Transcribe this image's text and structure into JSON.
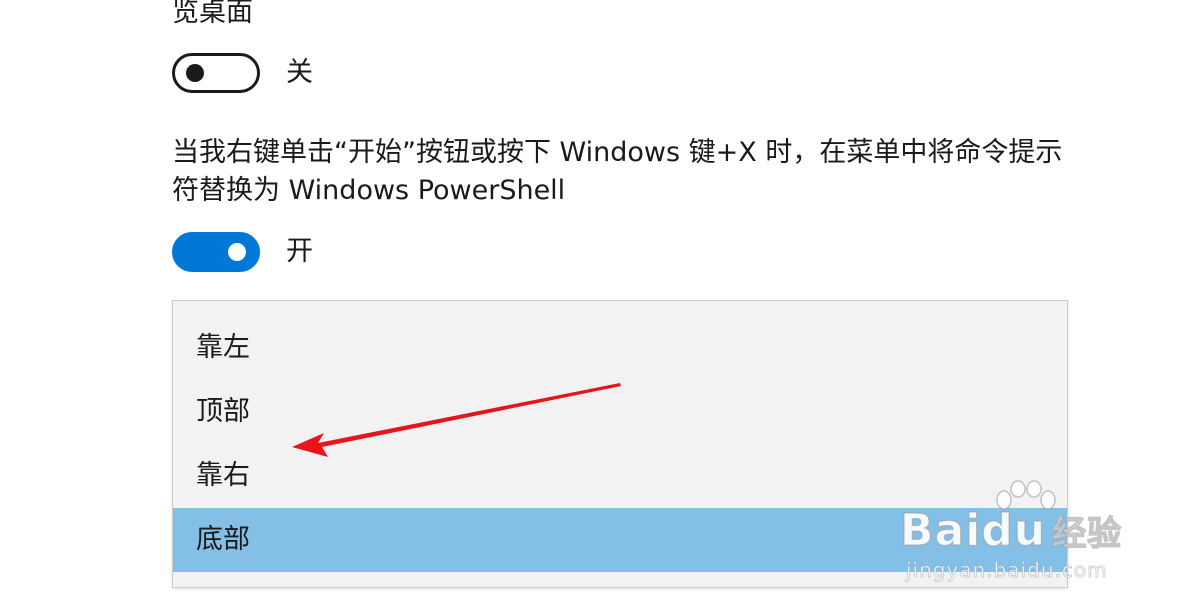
{
  "settings": {
    "peek_desktop": {
      "label_fragment": "览桌面",
      "toggle_state": false,
      "state_text": "关"
    },
    "powershell_replace": {
      "label": "当我右键单击“开始”按钮或按下 Windows 键+X 时，在菜单中将命令提示符替换为 Windows PowerShell",
      "toggle_state": true,
      "state_text": "开"
    }
  },
  "taskbar_position_dropdown": {
    "options": [
      "靠左",
      "顶部",
      "靠右",
      "底部"
    ],
    "selected": "底部"
  },
  "annotation": {
    "arrow_color": "#e8141c"
  },
  "watermark": {
    "brand": "Baidu",
    "brand_sub": "经验",
    "url": "jingyan.baidu.com"
  },
  "colors": {
    "toggle_on": "#0078d7",
    "selected_item": "#84bfe8",
    "dropdown_background": "#f2f2f2"
  }
}
